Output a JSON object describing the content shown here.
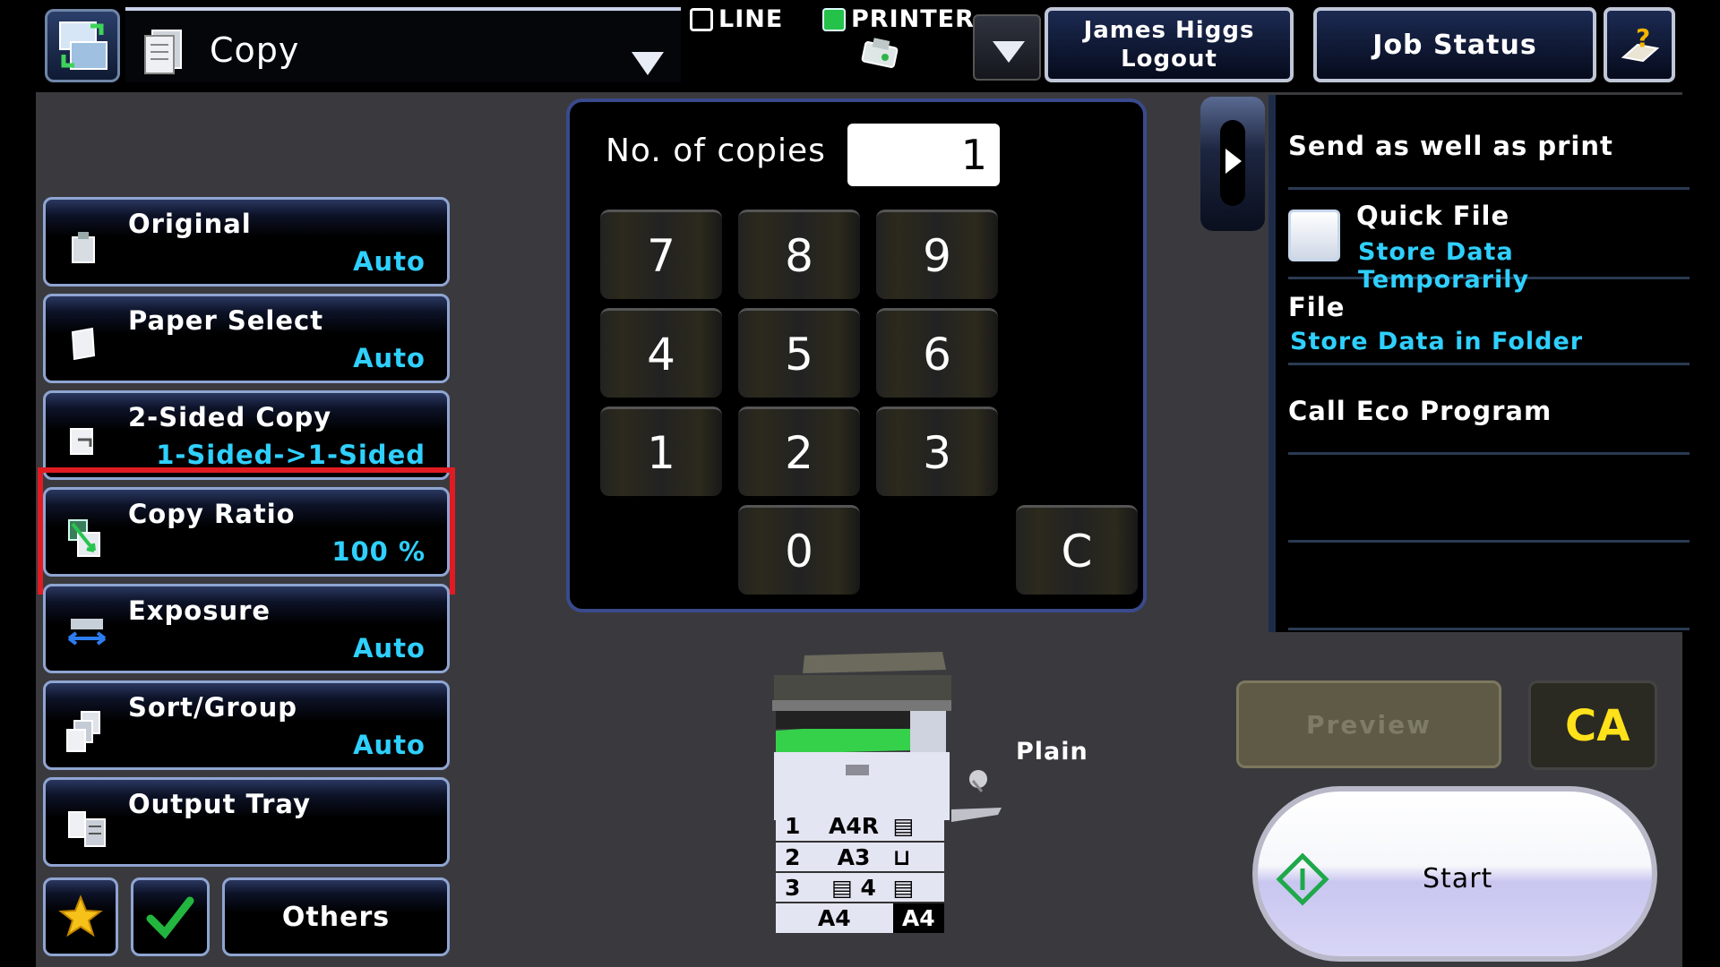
{
  "header": {
    "mode_title": "Copy",
    "status_line": "LINE",
    "status_printer": "PRINTER",
    "logout_user": "James Higgs",
    "logout_label": "Logout",
    "job_status": "Job Status"
  },
  "menu": {
    "items": [
      {
        "title": "Original",
        "value": "Auto"
      },
      {
        "title": "Paper Select",
        "value": "Auto"
      },
      {
        "title": "2-Sided Copy",
        "value": "1-Sided->1-Sided"
      },
      {
        "title": "Copy Ratio",
        "value": "100 %"
      },
      {
        "title": "Exposure",
        "value": "Auto"
      },
      {
        "title": "Sort/Group",
        "value": "Auto"
      },
      {
        "title": "Output Tray",
        "value": ""
      }
    ],
    "others": "Others"
  },
  "keypad": {
    "copies_label": "No. of copies",
    "copies_value": "1",
    "keys": [
      "7",
      "8",
      "9",
      "4",
      "5",
      "6",
      "1",
      "2",
      "3",
      "0",
      "C"
    ]
  },
  "right_panel": {
    "send_as_well": "Send as well as print",
    "quick_file": "Quick File",
    "quick_file_sub": "Store Data Temporarily",
    "file": "File",
    "file_sub": "Store Data in Folder",
    "eco": "Call Eco Program"
  },
  "machine": {
    "paper_type": "Plain",
    "trays": [
      {
        "num": "1",
        "size": "A4R"
      },
      {
        "num": "2",
        "size": "A3"
      },
      {
        "num": "3",
        "size": "A4"
      },
      {
        "num": "4",
        "size": "A4"
      }
    ]
  },
  "actions": {
    "preview": "Preview",
    "clear_all": "CA",
    "start": "Start"
  },
  "colors": {
    "accent_value": "#2fd0ff",
    "highlight": "#e11b22",
    "ca_text": "#ffe21a"
  }
}
